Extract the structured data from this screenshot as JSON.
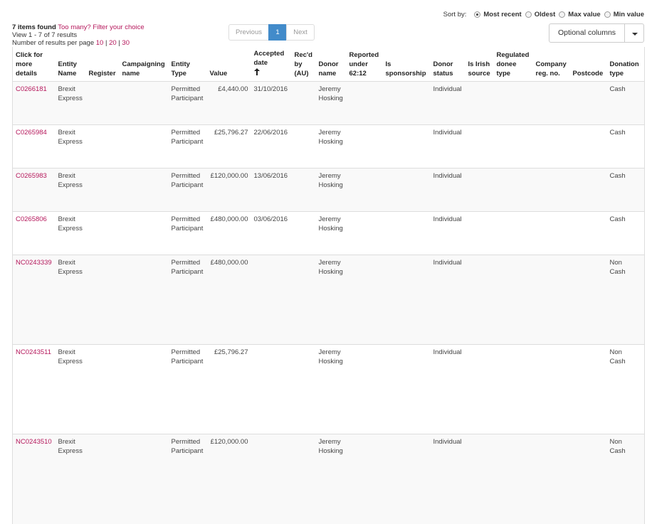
{
  "sort": {
    "label": "Sort by:",
    "options": [
      {
        "label": "Most recent",
        "selected": true
      },
      {
        "label": "Oldest",
        "selected": false
      },
      {
        "label": "Max value",
        "selected": false
      },
      {
        "label": "Min value",
        "selected": false
      }
    ]
  },
  "summary": {
    "count": "7 items found",
    "filter_link": "Too many? Filter your choice",
    "view_text": "View 1 - 7 of 7 results",
    "per_page_label": "Number of results per page",
    "per_page_options": [
      "10",
      "20",
      "30"
    ]
  },
  "pager": {
    "previous": "Previous",
    "current": "1",
    "next": "Next"
  },
  "optional_columns": {
    "label": "Optional columns"
  },
  "table": {
    "headers": {
      "details": [
        "Click for",
        "more",
        "details"
      ],
      "entity_name": [
        "Entity",
        "Name"
      ],
      "register": [
        "Register"
      ],
      "campaigning_name": [
        "Campaigning",
        "name"
      ],
      "entity_type": [
        "Entity",
        "Type"
      ],
      "value": [
        "Value"
      ],
      "accepted_date": [
        "Accepted",
        "date"
      ],
      "recd_by": [
        "Rec'd",
        "by",
        "(AU)"
      ],
      "donor_name": [
        "Donor",
        "name"
      ],
      "reported_under": [
        "Reported",
        "under",
        "62:12"
      ],
      "is_sponsorship": [
        "Is",
        "sponsorship"
      ],
      "donor_status": [
        "Donor",
        "status"
      ],
      "is_irish_source": [
        "Is Irish",
        "source"
      ],
      "regulated_donee_type": [
        "Regulated",
        "donee",
        "type"
      ],
      "company_reg_no": [
        "Company",
        "reg. no."
      ],
      "postcode": [
        "Postcode"
      ],
      "donation_type": [
        "Donation",
        "type"
      ]
    },
    "rows": [
      {
        "id": "C0266181",
        "entity": [
          "Brexit",
          "Express"
        ],
        "entity_type": [
          "Permitted",
          "Participant"
        ],
        "value": "£4,440.00",
        "date": "31/10/2016",
        "donor": [
          "Jeremy",
          "Hosking"
        ],
        "status": "Individual",
        "donation_type": [
          "Cash"
        ],
        "tall": false
      },
      {
        "id": "C0265984",
        "entity": [
          "Brexit",
          "Express"
        ],
        "entity_type": [
          "Permitted",
          "Participant"
        ],
        "value": "£25,796.27",
        "date": "22/06/2016",
        "donor": [
          "Jeremy",
          "Hosking"
        ],
        "status": "Individual",
        "donation_type": [
          "Cash"
        ],
        "tall": false
      },
      {
        "id": "C0265983",
        "entity": [
          "Brexit",
          "Express"
        ],
        "entity_type": [
          "Permitted",
          "Participant"
        ],
        "value": "£120,000.00",
        "date": "13/06/2016",
        "donor": [
          "Jeremy",
          "Hosking"
        ],
        "status": "Individual",
        "donation_type": [
          "Cash"
        ],
        "tall": false
      },
      {
        "id": "C0265806",
        "entity": [
          "Brexit",
          "Express"
        ],
        "entity_type": [
          "Permitted",
          "Participant"
        ],
        "value": "£480,000.00",
        "date": "03/06/2016",
        "donor": [
          "Jeremy",
          "Hosking"
        ],
        "status": "Individual",
        "donation_type": [
          "Cash"
        ],
        "tall": false
      },
      {
        "id": "NC0243339",
        "entity": [
          "Brexit",
          "Express"
        ],
        "entity_type": [
          "Permitted",
          "Participant"
        ],
        "value": "£480,000.00",
        "date": "",
        "donor": [
          "Jeremy",
          "Hosking"
        ],
        "status": "Individual",
        "donation_type": [
          "Non",
          "Cash"
        ],
        "tall": true
      },
      {
        "id": "NC0243511",
        "entity": [
          "Brexit",
          "Express"
        ],
        "entity_type": [
          "Permitted",
          "Participant"
        ],
        "value": "£25,796.27",
        "date": "",
        "donor": [
          "Jeremy",
          "Hosking"
        ],
        "status": "Individual",
        "donation_type": [
          "Non",
          "Cash"
        ],
        "tall": true
      },
      {
        "id": "NC0243510",
        "entity": [
          "Brexit",
          "Express"
        ],
        "entity_type": [
          "Permitted",
          "Participant"
        ],
        "value": "£120,000.00",
        "date": "",
        "donor": [
          "Jeremy",
          "Hosking"
        ],
        "status": "Individual",
        "donation_type": [
          "Non",
          "Cash"
        ],
        "tall": true
      }
    ]
  }
}
